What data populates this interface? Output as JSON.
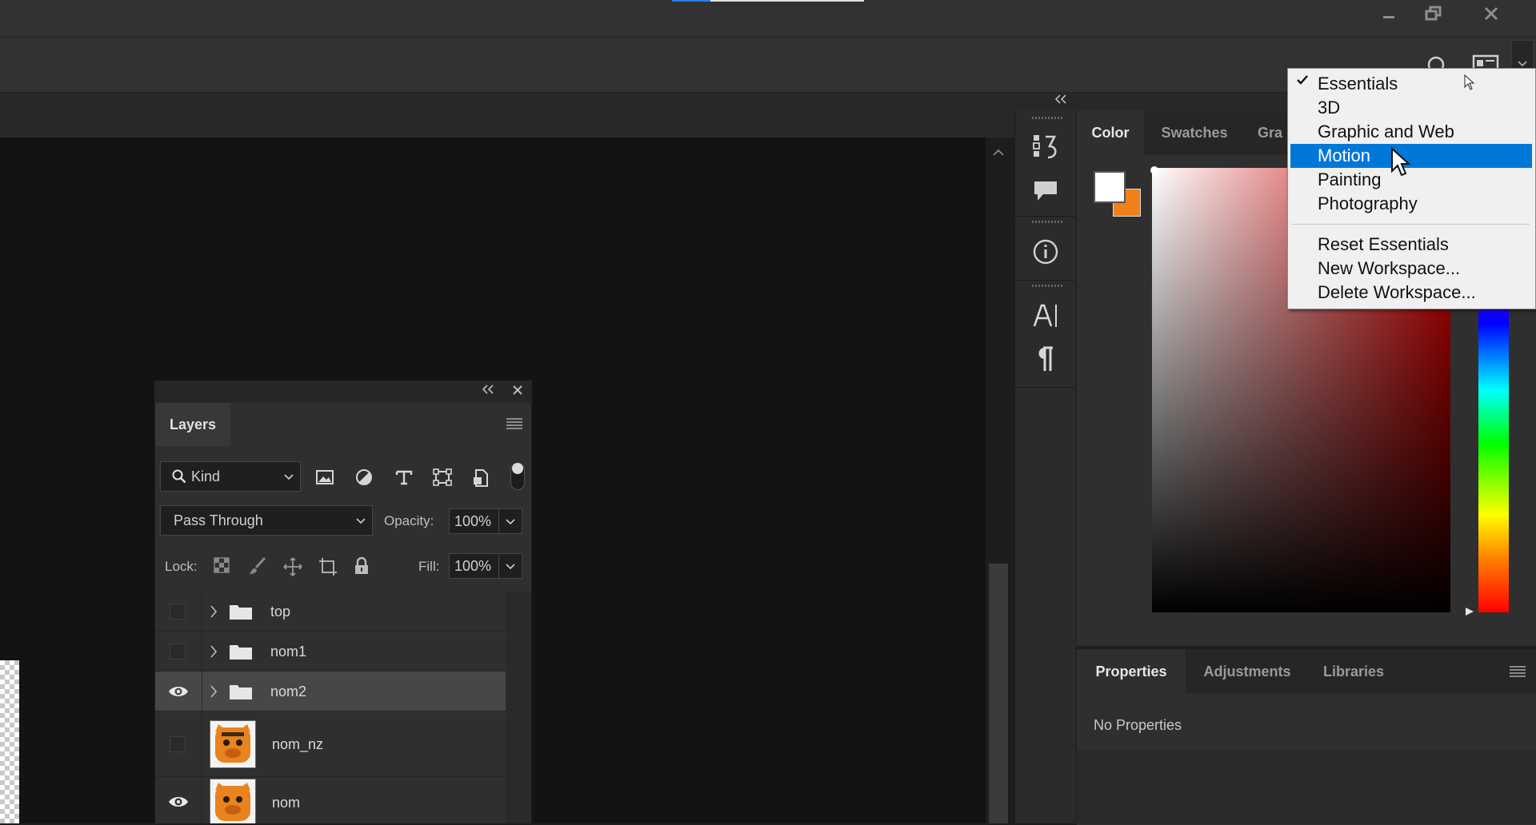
{
  "layers_panel": {
    "tab_label": "Layers",
    "filter": {
      "kind_label": "Kind"
    },
    "blend_mode": "Pass Through",
    "opacity_label": "Opacity:",
    "opacity_value": "100%",
    "lock_label": "Lock:",
    "fill_label": "Fill:",
    "fill_value": "100%",
    "layers": [
      {
        "name": "top",
        "type": "group",
        "visible": false,
        "selected": false
      },
      {
        "name": "nom1",
        "type": "group",
        "visible": false,
        "selected": false
      },
      {
        "name": "nom2",
        "type": "group",
        "visible": true,
        "selected": true
      },
      {
        "name": "nom_nz",
        "type": "layer",
        "visible": false,
        "selected": false
      },
      {
        "name": "nom",
        "type": "layer",
        "visible": true,
        "selected": false
      }
    ]
  },
  "color_panel": {
    "tabs": [
      "Color",
      "Swatches",
      "Gra"
    ],
    "active_tab": "Color",
    "foreground_color": "#ffffff",
    "background_color": "#f28019"
  },
  "properties_panel": {
    "tabs": [
      "Properties",
      "Adjustments",
      "Libraries"
    ],
    "active_tab": "Properties",
    "empty_text": "No Properties"
  },
  "workspace_menu": {
    "checked_item": "Essentials",
    "highlighted_item": "Motion",
    "items": [
      "Essentials",
      "3D",
      "Graphic and Web",
      "Motion",
      "Painting",
      "Photography"
    ],
    "actions": [
      "Reset Essentials",
      "New Workspace...",
      "Delete Workspace..."
    ]
  },
  "colors": {
    "menu_highlight": "#0078d7",
    "accent": "#2680eb",
    "layer_thumb_orange": "#e8831f"
  },
  "icons": {
    "window": [
      "minimize-icon",
      "restore-icon",
      "close-icon"
    ],
    "toolstrip": [
      "history-icon",
      "comment-icon",
      "info-icon",
      "character-icon",
      "paragraph-icon"
    ]
  }
}
